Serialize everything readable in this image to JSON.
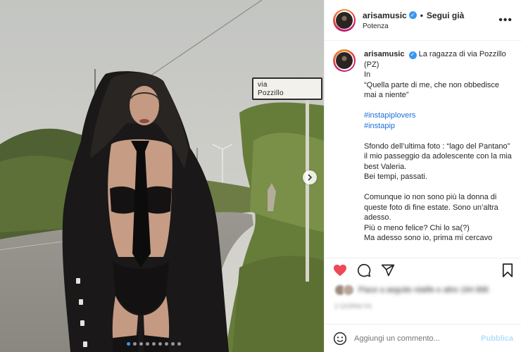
{
  "photo": {
    "sign_line1": "via",
    "sign_line2": "Pozzillo",
    "next_icon": "chevron-right-icon",
    "carousel_dots": 9,
    "active_dot": 0
  },
  "header": {
    "username": "arisamusic",
    "follow_status": "Segui già",
    "location": "Potenza",
    "more_icon": "more-horizontal-icon"
  },
  "caption": {
    "username": "arisamusic",
    "title": "La ragazza di via Pozzillo (PZ)",
    "lines_a": [
      "In",
      "“Quella parte di me, che non obbedisce mai a niente”"
    ],
    "hashtags": [
      "#instapiplovers",
      "#instapip"
    ],
    "lines_b": [
      "Sfondo dell’ultima foto : “lago del Pantano” il mio passeggio da adolescente con la mia best Valeria.",
      "Bei tempi, passati."
    ],
    "lines_c": [
      "Comunque io non sono più la donna di queste foto di fine estate. Sono un’altra adesso.",
      "Più o meno felice? Chi lo sa(?)",
      "Ma adesso sono io, prima mi cercavo"
    ]
  },
  "actions": {
    "like_icon": "heart-filled-icon",
    "comment_icon": "comment-icon",
    "share_icon": "send-icon",
    "save_icon": "bookmark-icon",
    "like_color": "#ed4956",
    "likes_text": "Piace a aeguite nlatife e altre 184 888",
    "date_text": "2 GIORNI FA"
  },
  "comment": {
    "emoji_icon": "emoji-icon",
    "placeholder": "Aggiungi un commento...",
    "publish_label": "Pubblica",
    "publish_color": "#b2dffc"
  },
  "colors": {
    "verified": "#3897f0",
    "hashtag": "#1d6fd6"
  }
}
